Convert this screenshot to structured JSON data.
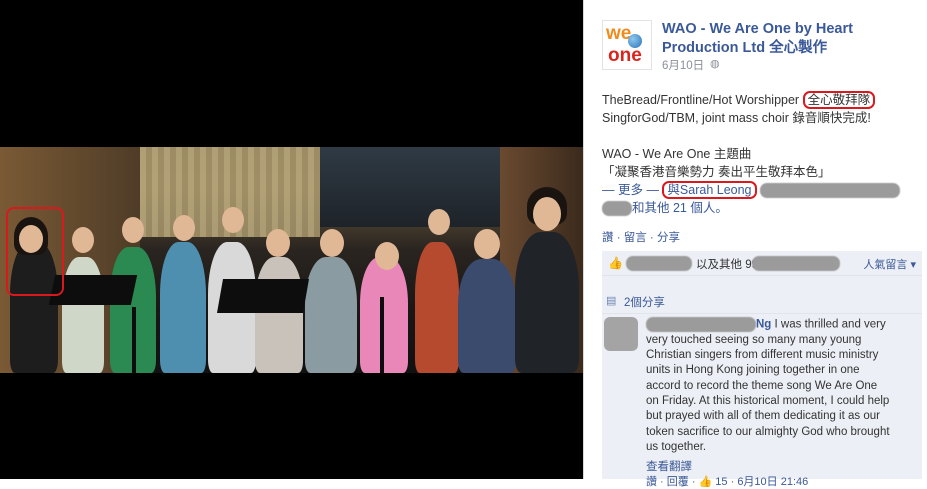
{
  "page": {
    "name_line1": "WAO - We Are One by Heart",
    "name_line2": "Production Ltd 全心製作",
    "date": "6月10日",
    "logo_we": "we",
    "logo_one": "one"
  },
  "post": {
    "line1_prefix": "TheBread/Frontline/Hot Worshipper ",
    "line1_highlight": "全心敬拜隊",
    "line2": "SingforGod/TBM, joint mass choir 錄音順快完成!",
    "line3": "WAO - We Are One 主題曲",
    "line4": "「凝聚香港音樂勢力 奏出平生敬拜本色」",
    "line5_prefix": "— 更多 — ",
    "line5_tag": "與Sarah Leong",
    "line6_suffix": "和其他 21 個人。"
  },
  "actions": {
    "like": "讚",
    "comment": "留言",
    "share": "分享"
  },
  "likes": {
    "text": "以及其他 99 人都說讚。",
    "top_comments": "人氣留言 ▾"
  },
  "shares": {
    "text": "2個分享"
  },
  "comment": {
    "name_suffix": "Ng",
    "text_line1": " I was thrilled and very",
    "text_line2": "very touched seeing so many many young",
    "text_line3": "Christian singers from different music ministry",
    "text_line4": "units in Hong Kong joining together in one",
    "text_line5": "accord to record the theme song We Are One",
    "text_line6": "on Friday. At this historical moment, I could help",
    "text_line7": "but prayed with all of them dedicating it as our",
    "text_line8": "token sacrifice to our almighty God who brought",
    "text_line9": "us together.",
    "translate": "查看翻譯",
    "meta": "讚 · 回覆 · 👍 15 · 6月10日 21:46"
  },
  "colors": {
    "link": "#3b5998",
    "highlight_box": "#d9191e",
    "likes_bg": "#eceff5"
  },
  "icons": {
    "globe": "globe-icon",
    "like": "thumbs-up-icon",
    "share": "share-icon"
  }
}
